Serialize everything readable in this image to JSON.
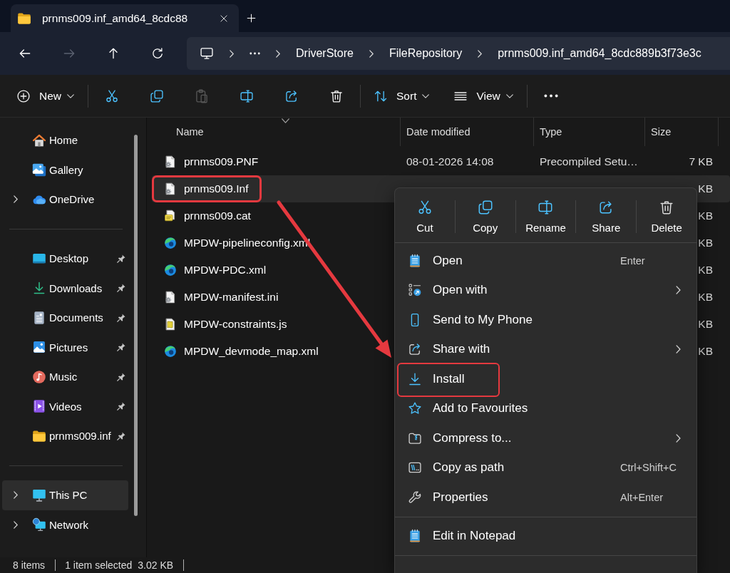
{
  "window": {
    "tabs": [
      {
        "title": "prnms009.inf_amd64_8cdc88",
        "selected": true
      }
    ]
  },
  "navigation": [
    {
      "kind": "back",
      "disabled": false
    },
    {
      "kind": "forward",
      "disabled": true
    },
    {
      "kind": "up",
      "disabled": false
    },
    {
      "kind": "refresh",
      "disabled": false
    }
  ],
  "address_bar": {
    "segments": [
      "DriverStore",
      "FileRepository",
      "prnms009.inf_amd64_8cdc889b3f73e3c"
    ]
  },
  "toolbar": {
    "groups": [
      {
        "items": [
          {
            "kind": "new",
            "label": "New",
            "dropdown": true,
            "disabled": false
          }
        ]
      },
      {
        "items": [
          {
            "kind": "cut",
            "dropdown": false,
            "disabled": false
          },
          {
            "kind": "copy",
            "dropdown": false,
            "disabled": false
          },
          {
            "kind": "paste",
            "dropdown": false,
            "disabled": true
          },
          {
            "kind": "rename",
            "dropdown": false,
            "disabled": false
          },
          {
            "kind": "share",
            "dropdown": false,
            "disabled": false
          },
          {
            "kind": "delete",
            "dropdown": false,
            "disabled": false
          }
        ]
      },
      {
        "items": [
          {
            "kind": "sort",
            "label": "Sort",
            "dropdown": true,
            "disabled": false
          },
          {
            "kind": "view",
            "label": "View",
            "dropdown": true,
            "disabled": false
          }
        ]
      },
      {
        "items": [
          {
            "kind": "more",
            "dropdown": false,
            "disabled": false
          }
        ]
      }
    ]
  },
  "sidebar": {
    "sections": [
      {
        "items": [
          {
            "kind": "home",
            "label": "Home",
            "expandable": false,
            "pinned": false,
            "selected": false
          },
          {
            "kind": "gallery",
            "label": "Gallery",
            "expandable": false,
            "pinned": false,
            "selected": false
          },
          {
            "kind": "cloud",
            "label": "OneDrive",
            "expandable": true,
            "pinned": false,
            "selected": false
          }
        ]
      },
      {
        "items": [
          {
            "kind": "desktop",
            "label": "Desktop",
            "expandable": false,
            "pinned": true,
            "selected": false
          },
          {
            "kind": "downloads",
            "label": "Downloads",
            "expandable": false,
            "pinned": true,
            "selected": false
          },
          {
            "kind": "documents",
            "label": "Documents",
            "expandable": false,
            "pinned": true,
            "selected": false
          },
          {
            "kind": "pictures",
            "label": "Pictures",
            "expandable": false,
            "pinned": true,
            "selected": false
          },
          {
            "kind": "music",
            "label": "Music",
            "expandable": false,
            "pinned": true,
            "selected": false
          },
          {
            "kind": "videos",
            "label": "Videos",
            "expandable": false,
            "pinned": true,
            "selected": false
          },
          {
            "kind": "folder",
            "label": "prnms009.inf",
            "expandable": false,
            "pinned": true,
            "selected": false
          }
        ]
      },
      {
        "items": [
          {
            "kind": "pc",
            "label": "This PC",
            "expandable": true,
            "pinned": false,
            "selected": true
          },
          {
            "kind": "network",
            "label": "Network",
            "expandable": true,
            "pinned": false,
            "selected": false
          }
        ]
      }
    ]
  },
  "file_list": {
    "columns": [
      {
        "label": "Name",
        "sorted": true
      },
      {
        "label": "Date modified",
        "sorted": false
      },
      {
        "label": "Type",
        "sorted": false
      },
      {
        "label": "Size",
        "sorted": false
      }
    ],
    "rows": [
      {
        "kind": "settings",
        "name": "prnms009.PNF",
        "date_modified": "08-01-2026 14:08",
        "type": "Precompiled Setu…",
        "size": "7 KB",
        "selected": false,
        "annotated": false
      },
      {
        "kind": "settings",
        "name": "prnms009.Inf",
        "size": "KB",
        "selected": true,
        "annotated": true
      },
      {
        "kind": "catalog",
        "name": "prnms009.cat",
        "size": "KB",
        "selected": false,
        "annotated": false
      },
      {
        "kind": "web",
        "name": "MPDW-pipelineconfig.xml",
        "size": "KB",
        "selected": false,
        "annotated": false
      },
      {
        "kind": "web",
        "name": "MPDW-PDC.xml",
        "size": "KB",
        "selected": false,
        "annotated": false
      },
      {
        "kind": "settings",
        "name": "MPDW-manifest.ini",
        "size": "KB",
        "selected": false,
        "annotated": false
      },
      {
        "kind": "script",
        "name": "MPDW-constraints.js",
        "size": "KB",
        "selected": false,
        "annotated": false
      },
      {
        "kind": "web",
        "name": "MPDW_devmode_map.xml",
        "size": "KB",
        "selected": false,
        "annotated": false
      }
    ]
  },
  "context_menu": {
    "quick_actions": [
      {
        "kind": "cut",
        "label": "Cut"
      },
      {
        "kind": "copy",
        "label": "Copy"
      },
      {
        "kind": "rename",
        "label": "Rename"
      },
      {
        "kind": "share",
        "label": "Share"
      },
      {
        "kind": "delete",
        "label": "Delete"
      }
    ],
    "sections": [
      {
        "items": [
          {
            "kind": "open",
            "label": "Open",
            "shortcut": "Enter",
            "submenu": false,
            "annotated": false
          },
          {
            "kind": "open-with",
            "label": "Open with",
            "submenu": true,
            "annotated": false
          },
          {
            "kind": "phone",
            "label": "Send to My Phone",
            "submenu": false,
            "annotated": false
          },
          {
            "kind": "share-with",
            "label": "Share with",
            "submenu": true,
            "annotated": false
          },
          {
            "kind": "install",
            "label": "Install",
            "submenu": false,
            "annotated": true
          },
          {
            "kind": "favourite",
            "label": "Add to Favourites",
            "submenu": false,
            "annotated": false
          },
          {
            "kind": "compress",
            "label": "Compress to...",
            "submenu": true,
            "annotated": false
          },
          {
            "kind": "copy-path",
            "label": "Copy as path",
            "shortcut": "Ctrl+Shift+C",
            "submenu": false,
            "annotated": false
          },
          {
            "kind": "properties",
            "label": "Properties",
            "shortcut": "Alt+Enter",
            "submenu": false,
            "annotated": false
          }
        ]
      },
      {
        "items": [
          {
            "kind": "edit",
            "label": "Edit in Notepad",
            "submenu": false,
            "annotated": false
          }
        ]
      }
    ]
  },
  "status_bar": {
    "item_count": "8 items",
    "selection": "1 item selected",
    "selection_size": "3.02 KB"
  }
}
